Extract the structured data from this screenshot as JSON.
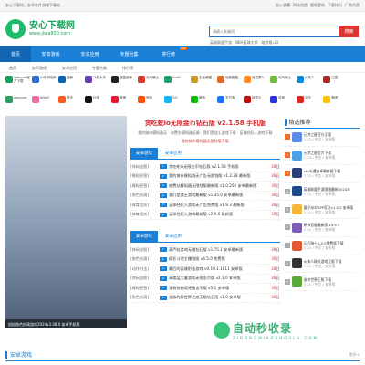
{
  "topbar": {
    "left": "安心下载网，安卓软件游戏下载站",
    "links": [
      "加入收藏",
      "网站地图",
      "最新更新",
      "下载排行",
      "厂商列表"
    ]
  },
  "header": {
    "logo_name": "安心下载网",
    "logo_domain": "www.jiwa800.com",
    "search_placeholder": "请输入关键词",
    "search_button": "搜索",
    "hotwords": [
      "英雄联盟手游",
      "NBA篮球大师",
      "暗影格斗3"
    ]
  },
  "nav": [
    {
      "label": "首页",
      "active": true
    },
    {
      "label": "安卓游戏"
    },
    {
      "label": "安卓应用"
    },
    {
      "label": "专题合集"
    },
    {
      "label": "排行榜",
      "badge": "TOP"
    }
  ],
  "categories": [
    "首页",
    "安卓游戏",
    "安卓应用",
    "专题合集",
    "排行榜",
    "角色扮演",
    "安卓游戏",
    "安卓应用",
    "专题合集",
    "排行榜",
    "策略",
    "动作",
    "射击"
  ],
  "apps": [
    {
      "name": "apkpure官方下载",
      "color": "#1a9e5c"
    },
    {
      "name": "小叶子陪练",
      "color": "#2b6fd1"
    },
    {
      "name": "蓝鲸",
      "color": "#0a62b0"
    },
    {
      "name": "飞机大亨",
      "color": "#6a3fb8"
    },
    {
      "name": "迷笛老师",
      "color": "#222222"
    },
    {
      "name": "元气骑士",
      "color": "#d83a2e"
    },
    {
      "name": "hiwhi",
      "color": "#20a46b"
    },
    {
      "name": "王者荣耀",
      "color": "#c99b2a"
    },
    {
      "name": "地铁跑酷",
      "color": "#e06b1f"
    },
    {
      "name": "保卫萝卜",
      "color": "#ff8a1e"
    },
    {
      "name": "元气骑士",
      "color": "#6dbd3b"
    },
    {
      "name": "火柴人",
      "color": "#0d88d1"
    },
    {
      "name": "三国",
      "color": "#a52a2a"
    },
    {
      "name": "apkpure",
      "color": "#2a9f5e"
    },
    {
      "name": "bilibili",
      "color": "#ee6c9e"
    },
    {
      "name": "快手",
      "color": "#ff5a1f"
    },
    {
      "name": "抖音",
      "color": "#111111"
    },
    {
      "name": "微博",
      "color": "#e6162d"
    },
    {
      "name": "淘宝",
      "color": "#ff5000"
    },
    {
      "name": "QQ",
      "color": "#12b7f5"
    },
    {
      "name": "微信",
      "color": "#09bb07"
    },
    {
      "name": "支付宝",
      "color": "#1677ff"
    },
    {
      "name": "网易云",
      "color": "#c20c0c"
    },
    {
      "name": "百度",
      "color": "#2932e1"
    },
    {
      "name": "京东",
      "color": "#e1251b"
    },
    {
      "name": "美团",
      "color": "#ffc300"
    }
  ],
  "banner": {
    "caption": "旭旭角色扮演游戏2024v3.08.0 安卓手机版"
  },
  "headline": "贪吃蛇io无限金币钻石版 v2.1.58 手机版",
  "subline1": "我的城市模拟器无 · 收费台模拟器无限 · 我们是战士游戏下载 · 足球经纪人游戏下载",
  "subline2": "我的城市模拟器无限钱版下载",
  "tabs": [
    "安卓游戏",
    "安卓应用"
  ],
  "list1": [
    {
      "tag": "[休闲益智]",
      "num": "1",
      "title": "贪吃蛇io无限金币钻石版 v2.1.58 手机版",
      "date": "30日"
    },
    {
      "tag": "[模拟经营]",
      "num": "2",
      "title": "我的城市模拟器无广告无限钱版 v1.2.28 最新版",
      "date": "30日"
    },
    {
      "tag": "[模拟经营]",
      "num": "3",
      "title": "收费站模拟器无限钱版最新版 v1.0.256 安卓最新版",
      "date": "30日"
    },
    {
      "tag": "[角色扮演]",
      "num": "4",
      "title": "我们是战士游戏最新版 v1.35.0 安卓最新版",
      "date": "30日"
    },
    {
      "tag": "[体育竞技]",
      "num": "5",
      "title": "足球经纪人游戏无广告免费版 v1.9.3 最新版",
      "date": "30日"
    },
    {
      "tag": "[体育竞技]",
      "num": "6",
      "title": "足球经纪人游戏最新版 v2.9.6 最新版",
      "date": "30日"
    }
  ],
  "list2": [
    {
      "tag": "[休闲益智]",
      "num": "1",
      "title": "葫芦娃游戏无限钻石版 v1.75.1 安卓最新版",
      "date": "30日"
    },
    {
      "tag": "[角色扮演]",
      "num": "2",
      "title": "疯狂斗地主赚钱版 v4.5.0 免费版",
      "date": "30日"
    },
    {
      "tag": "[动作射击]",
      "num": "3",
      "title": "最后的英雄射击游戏 v0.19.1.1811 安卓版",
      "date": "30日"
    },
    {
      "tag": "[休闲益智]",
      "num": "4",
      "title": "高楼层大厦游戏无限金币版 v2.1.0 安卓版",
      "date": "30日"
    },
    {
      "tag": "[模拟经营]",
      "num": "5",
      "title": "宠物狗物语无限金币版 v5.1 安卓版",
      "date": "30日"
    },
    {
      "tag": "[角色扮演]",
      "num": "6",
      "title": "龙族的异世界之旅无限钻石版 v1.0 安卓版",
      "date": "30日"
    }
  ],
  "right": {
    "title": "精选推荐",
    "items": [
      {
        "rank": "1",
        "name": "元梦之星官方正版",
        "meta": "7.22 / 中文 / 安卓版",
        "color": "#5b8de8"
      },
      {
        "rank": "2",
        "name": "元梦之星官方下载",
        "meta": "7.22 / 中文 / 安卓版",
        "color": "#4ea0e6"
      },
      {
        "rank": "3",
        "name": "sky光遇安卓最新版下载",
        "meta": "7.22 / 中文 / 安卓版",
        "color": "#2c3e78"
      },
      {
        "rank": "4",
        "name": "英雄联盟手游国服最新2024年",
        "meta": "7.22 / 中文 / 安卓版",
        "color": "#1f4a8a"
      },
      {
        "rank": "5",
        "name": "蛋仔派对APP官方v1.0.2 安卓版",
        "meta": "7.22 / 中文 / 安卓版",
        "color": "#f3b73c"
      },
      {
        "rank": "6",
        "name": "原神官服最新版 v3.9.3",
        "meta": "7.22 / 中文 / 安卓版",
        "color": "#7d5bb8"
      },
      {
        "rank": "7",
        "name": "元气骑士5.5.0免费版下载",
        "meta": "7.22 / 中文 / 安卓版",
        "color": "#e25a34"
      },
      {
        "rank": "8",
        "name": "火柴人联机游戏正版下载",
        "meta": "7.22 / 中文 / 安卓版",
        "color": "#333333"
      },
      {
        "rank": "9",
        "name": "迷你世界正版下载",
        "meta": "7.22 / 中文 / 安卓版",
        "color": "#58a83a"
      }
    ]
  },
  "section2": {
    "title": "安卓游戏",
    "more": "更多+"
  },
  "watermark": {
    "big": "自动秒收录",
    "small": "ZIDONGMIAOSHOULU.COM"
  }
}
